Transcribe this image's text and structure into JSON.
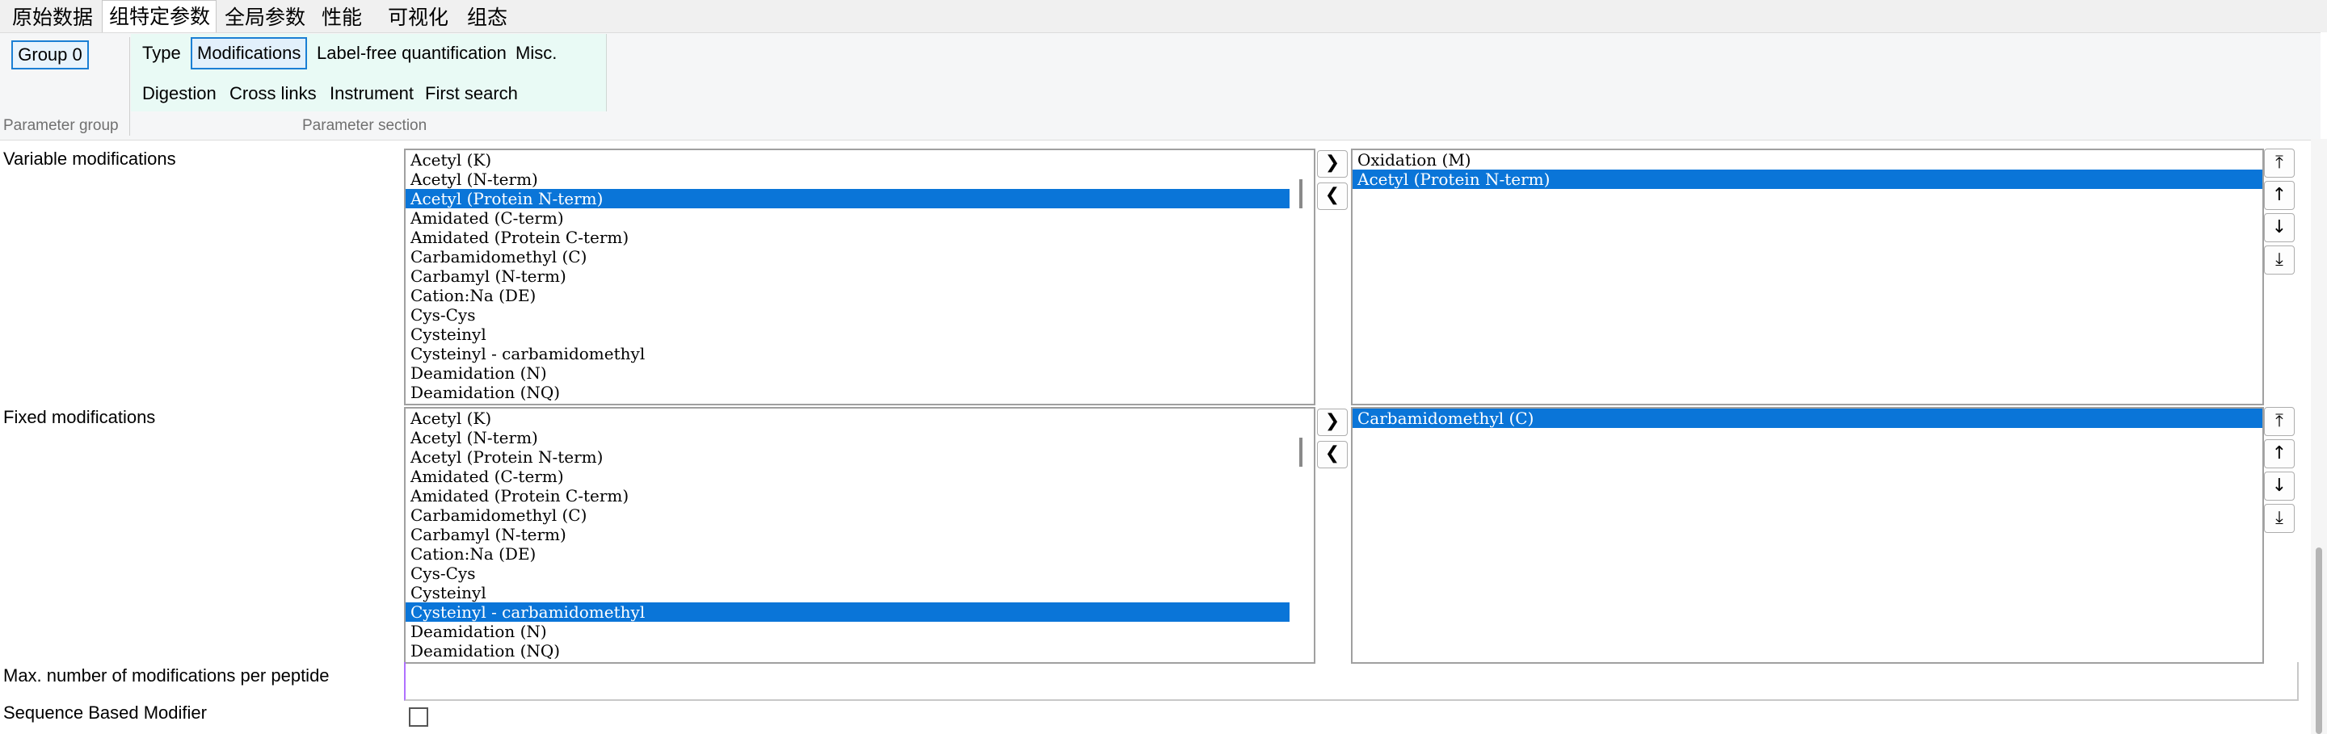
{
  "tabs": [
    {
      "label": "原始数据",
      "active": false
    },
    {
      "label": "组特定参数",
      "active": true
    },
    {
      "label": "全局参数",
      "active": false
    },
    {
      "label": "性能",
      "active": false
    },
    {
      "label": "可视化",
      "active": false
    },
    {
      "label": "组态",
      "active": false
    }
  ],
  "ribbon": {
    "group_button": "Group 0",
    "group_caption": "Parameter group",
    "section_caption": "Parameter section",
    "row1": [
      "Type",
      "Modifications",
      "Label-free quantification",
      "Misc."
    ],
    "row2": [
      "Digestion",
      "Cross links",
      "Instrument",
      "First search"
    ],
    "selected": "Modifications"
  },
  "variable": {
    "label": "Variable modifications",
    "available": [
      "Acetyl (K)",
      "Acetyl (N-term)",
      "Acetyl (Protein N-term)",
      "Amidated (C-term)",
      "Amidated (Protein C-term)",
      "Carbamidomethyl (C)",
      "Carbamyl (N-term)",
      "Cation:Na (DE)",
      "Cys-Cys",
      "Cysteinyl",
      "Cysteinyl - carbamidomethyl",
      "Deamidation (N)",
      "Deamidation (NQ)"
    ],
    "available_selected": "Acetyl (Protein N-term)",
    "chosen": [
      "Oxidation (M)",
      "Acetyl (Protein N-term)"
    ],
    "chosen_selected": "Acetyl (Protein N-term)"
  },
  "fixed": {
    "label": "Fixed modifications",
    "available": [
      "Acetyl (K)",
      "Acetyl (N-term)",
      "Acetyl (Protein N-term)",
      "Amidated (C-term)",
      "Amidated (Protein C-term)",
      "Carbamidomethyl (C)",
      "Carbamyl (N-term)",
      "Cation:Na (DE)",
      "Cys-Cys",
      "Cysteinyl",
      "Cysteinyl - carbamidomethyl",
      "Deamidation (N)",
      "Deamidation (NQ)"
    ],
    "available_selected": "Cysteinyl - carbamidomethyl",
    "chosen": [
      "Carbamidomethyl (C)"
    ],
    "chosen_selected": "Carbamidomethyl (C)"
  },
  "max_mods": {
    "label": "Max. number of modifications per peptide",
    "value": ""
  },
  "sequence_based": {
    "label": "Sequence Based Modifier",
    "checked": false
  },
  "icons": {
    "add": "chevron-right-icon",
    "remove": "chevron-left-icon",
    "top": "move-top-icon",
    "up": "move-up-icon",
    "down": "move-down-icon",
    "bottom": "move-bottom-icon"
  },
  "colors": {
    "selection": "#0a75d8",
    "section_bg": "#e9faf5",
    "accent_border": "#1a7fd4"
  }
}
